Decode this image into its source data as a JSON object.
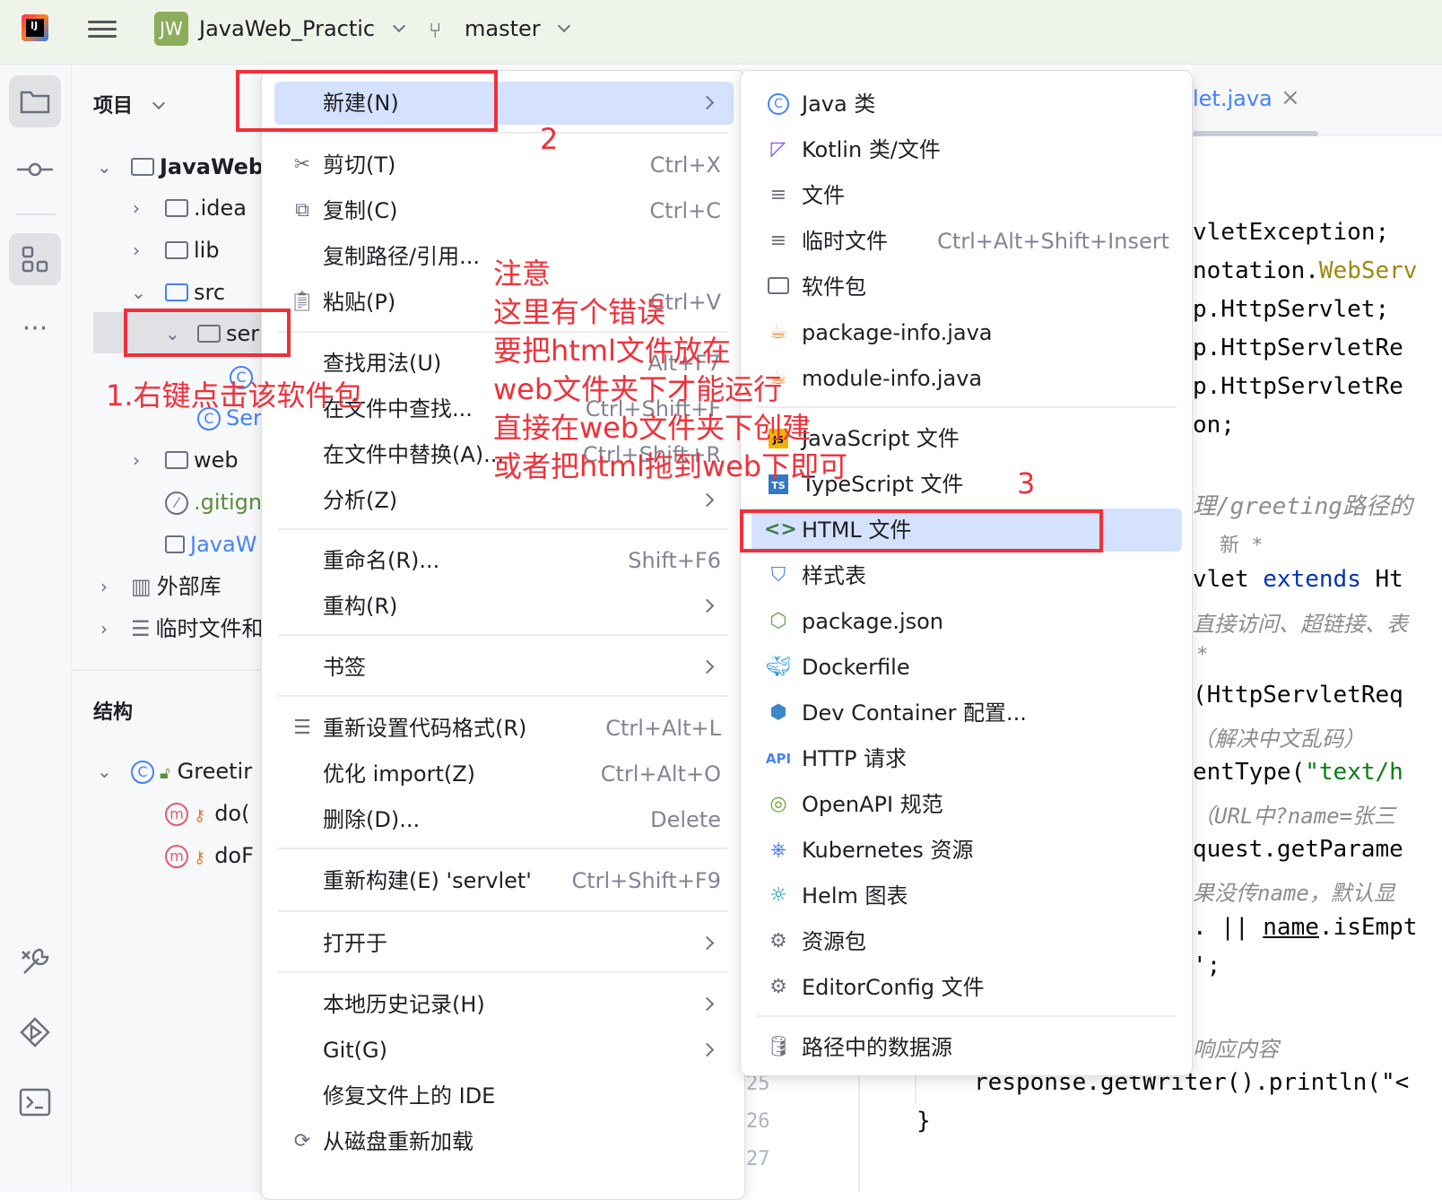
{
  "titlebar": {
    "project_badge": "JW",
    "project_name": "JavaWeb_Practic",
    "branch": "master"
  },
  "project_panel": {
    "title": "项目",
    "tree": {
      "root": "JavaWeb_",
      "idea": ".idea",
      "lib": "lib",
      "src": "src",
      "servlet_pkg": "ser",
      "servlet_class": "Ser",
      "web": "web",
      "gitignore": ".gitign",
      "iml": "JavaW",
      "external_libs": "外部库",
      "scratches": "临时文件和"
    },
    "structure_title": "结构",
    "structure": {
      "class_name": "Greetir",
      "method1": "do(",
      "method2": "doF"
    }
  },
  "context_menu": {
    "items": [
      {
        "label": "新建(N)",
        "shortcut": ""
      },
      {
        "label": "剪切(T)",
        "shortcut": "Ctrl+X"
      },
      {
        "label": "复制(C)",
        "shortcut": "Ctrl+C"
      },
      {
        "label": "复制路径/引用...",
        "shortcut": ""
      },
      {
        "label": "粘贴(P)",
        "shortcut": "Ctrl+V"
      },
      {
        "label": "查找用法(U)",
        "shortcut": "Alt+F7"
      },
      {
        "label": "在文件中查找...",
        "shortcut": "Ctrl+Shift+F"
      },
      {
        "label": "在文件中替换(A)...",
        "shortcut": "Ctrl+Shift+R"
      },
      {
        "label": "分析(Z)",
        "shortcut": ""
      },
      {
        "label": "重命名(R)...",
        "shortcut": "Shift+F6"
      },
      {
        "label": "重构(R)",
        "shortcut": ""
      },
      {
        "label": "书签",
        "shortcut": ""
      },
      {
        "label": "重新设置代码格式(R)",
        "shortcut": "Ctrl+Alt+L"
      },
      {
        "label": "优化 import(Z)",
        "shortcut": "Ctrl+Alt+O"
      },
      {
        "label": "删除(D)...",
        "shortcut": "Delete"
      },
      {
        "label": "重新构建(E) 'servlet'",
        "shortcut": "Ctrl+Shift+F9"
      },
      {
        "label": "打开于",
        "shortcut": ""
      },
      {
        "label": "本地历史记录(H)",
        "shortcut": ""
      },
      {
        "label": "Git(G)",
        "shortcut": ""
      },
      {
        "label": "修复文件上的 IDE",
        "shortcut": ""
      },
      {
        "label": "从磁盘重新加载",
        "shortcut": ""
      }
    ]
  },
  "submenu": {
    "items": [
      {
        "label": "Java 类",
        "shortcut": ""
      },
      {
        "label": "Kotlin 类/文件",
        "shortcut": ""
      },
      {
        "label": "文件",
        "shortcut": ""
      },
      {
        "label": "临时文件",
        "shortcut": "Ctrl+Alt+Shift+Insert"
      },
      {
        "label": "软件包",
        "shortcut": ""
      },
      {
        "label": "package-info.java",
        "shortcut": ""
      },
      {
        "label": "module-info.java",
        "shortcut": ""
      },
      {
        "label": "JavaScript 文件",
        "shortcut": ""
      },
      {
        "label": "TypeScript 文件",
        "shortcut": ""
      },
      {
        "label": "HTML 文件",
        "shortcut": ""
      },
      {
        "label": "样式表",
        "shortcut": ""
      },
      {
        "label": "package.json",
        "shortcut": ""
      },
      {
        "label": "Dockerfile",
        "shortcut": ""
      },
      {
        "label": "Dev Container 配置...",
        "shortcut": ""
      },
      {
        "label": "HTTP 请求",
        "shortcut": ""
      },
      {
        "label": "OpenAPI 规范",
        "shortcut": ""
      },
      {
        "label": "Kubernetes 资源",
        "shortcut": ""
      },
      {
        "label": "Helm 图表",
        "shortcut": ""
      },
      {
        "label": "资源包",
        "shortcut": ""
      },
      {
        "label": "EditorConfig 文件",
        "shortcut": ""
      },
      {
        "label": "路径中的数据源",
        "shortcut": ""
      }
    ]
  },
  "editor": {
    "tab_title": "let.java",
    "lines": [
      "vletException;",
      "notation.",
      "WebServ",
      "p.HttpServlet;",
      "p.HttpServletRe",
      "p.HttpServletRe",
      "on;",
      "理/greeting路径的",
      "新 *",
      "vlet ",
      "extends",
      " Ht",
      "直接访问、超链接、表",
      "*",
      "(HttpServletReq",
      "（解决中文乱码）",
      "entType(",
      "\"text/h",
      "（URL中?name=张三",
      "quest.getParame",
      "果没传name，默认显",
      ". || ",
      "name",
      ".isEmpt",
      "';",
      "响应内容",
      "response.getWriter().println(\"<",
      "}"
    ],
    "line_numbers": [
      "25",
      "26",
      "27"
    ]
  },
  "annotations": {
    "step1": "1.右键点击该软件包",
    "step2": "2",
    "step3": "3",
    "note_title": "注意",
    "note_lines": [
      "这里有个错误",
      "要把html文件放在",
      "web文件夹下才能运行",
      "直接在web文件夹下创建",
      "或者把html拖到web下即可"
    ],
    "color": "#f0303a"
  },
  "colors": {
    "selection": "#d4e2ff",
    "accent": "#4682fa",
    "badge": "#8cae5c"
  }
}
